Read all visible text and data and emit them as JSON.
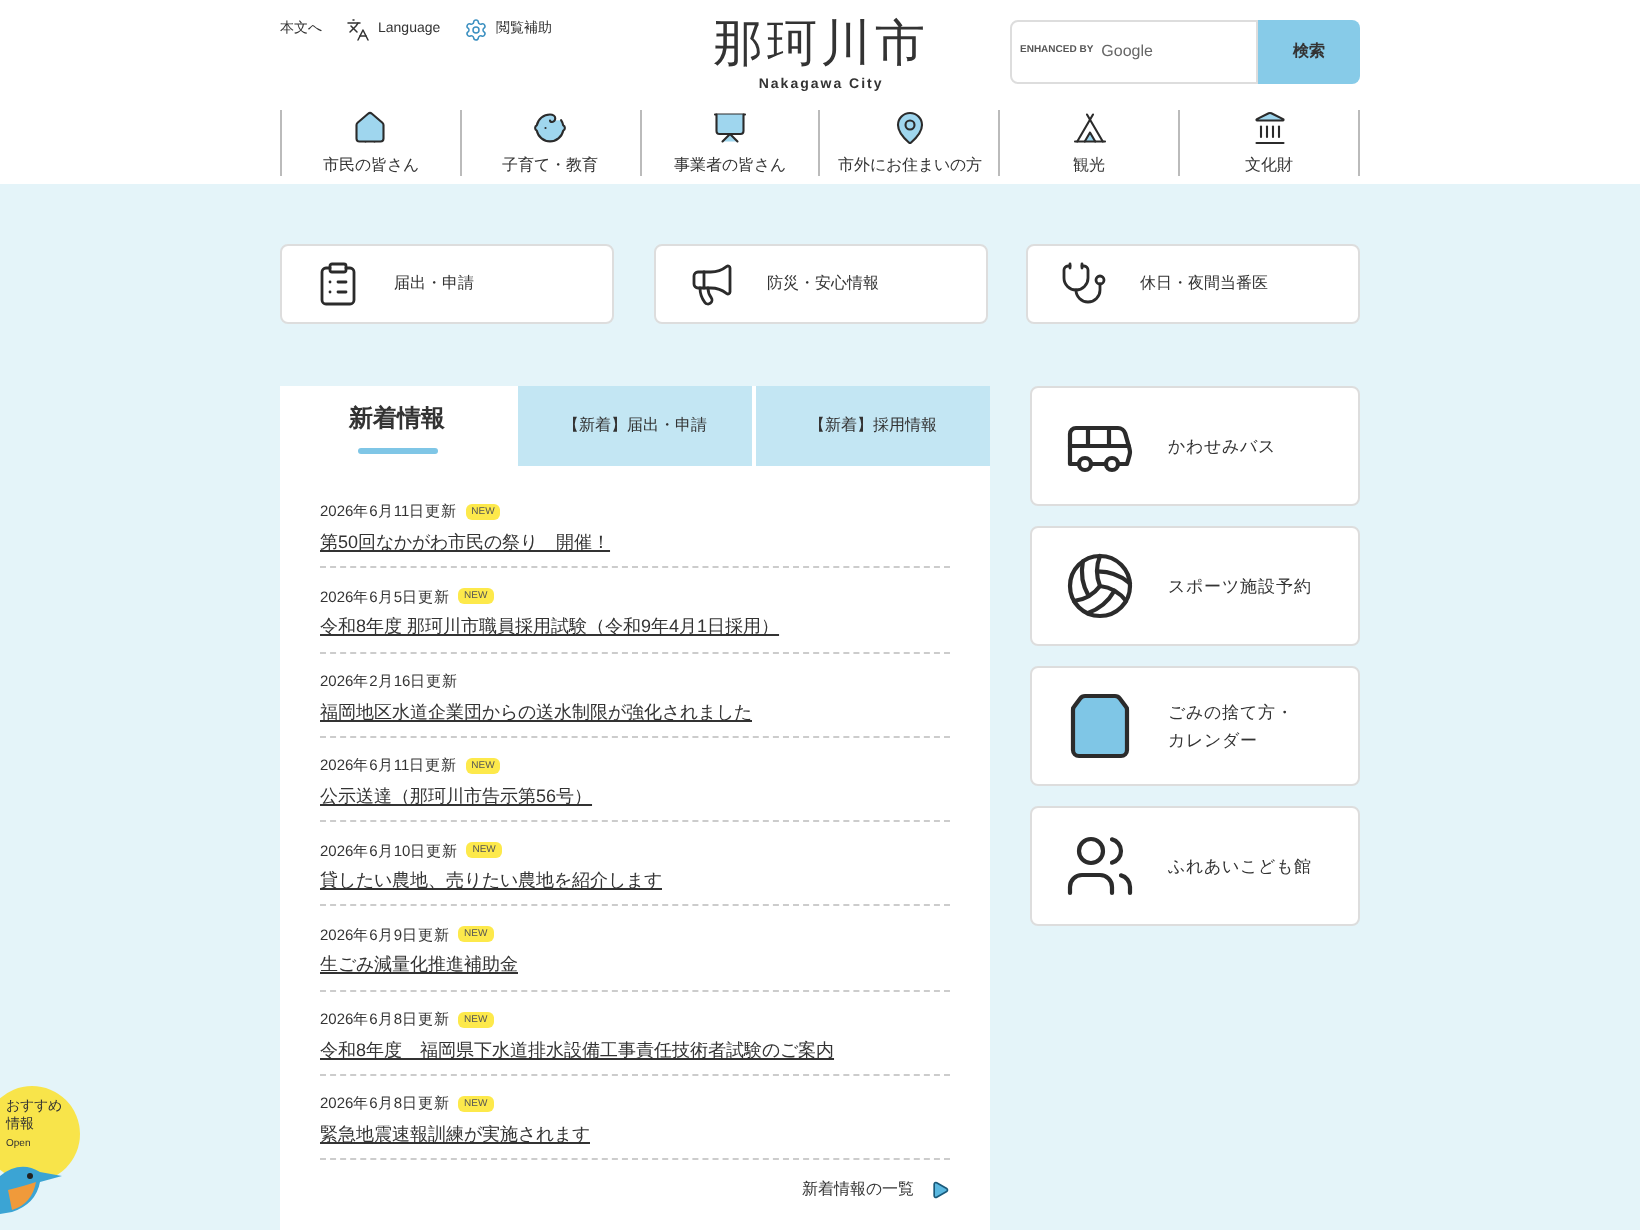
{
  "header": {
    "top_links": [
      {
        "label": "本文へ",
        "kind": "text"
      },
      {
        "label": "Language",
        "kind": "language"
      },
      {
        "label": "閲覧補助",
        "kind": "accessibility"
      }
    ],
    "logo": {
      "title": "那珂川市",
      "subtitle": "Nakagawa City"
    },
    "search": {
      "brand_prefix": "ENHANCED BY",
      "brand": "Google",
      "button": "検索"
    }
  },
  "nav": [
    {
      "label": "市民の皆さん",
      "kind": "home"
    },
    {
      "label": "子育て・教育",
      "kind": "family"
    },
    {
      "label": "事業者の皆さん",
      "kind": "business"
    },
    {
      "label": "市外にお住まいの方",
      "kind": "map"
    },
    {
      "label": "観光",
      "kind": "tent"
    },
    {
      "label": "文化財",
      "kind": "culture"
    }
  ],
  "quick_links": [
    {
      "label": "届出・申請",
      "kind": "form"
    },
    {
      "label": "防災・安心情報",
      "kind": "disaster"
    },
    {
      "label": "休日・夜間当番医",
      "kind": "doctor"
    }
  ],
  "news": {
    "tabs": [
      {
        "label": "新着情報",
        "selected": true
      },
      {
        "label": "【新着】届出・申請",
        "selected": false
      },
      {
        "label": "【新着】採用情報",
        "selected": false
      }
    ],
    "items": [
      {
        "date": "2026年6月11日更新",
        "new": true,
        "new_label": "NEW",
        "title": "第50回なかがわ市民の祭り　開催！"
      },
      {
        "date": "2026年6月5日更新",
        "new": true,
        "new_label": "NEW",
        "title": "令和8年度 那珂川市職員採用試験（令和9年4月1日採用）"
      },
      {
        "date": "2026年2月16日更新",
        "new": false,
        "title": "福岡地区水道企業団からの送水制限が強化されました"
      },
      {
        "date": "2026年6月11日更新",
        "new": true,
        "new_label": "NEW",
        "title": "公示送達（那珂川市告示第56号）"
      },
      {
        "date": "2026年6月10日更新",
        "new": true,
        "new_label": "NEW",
        "title": "貸したい農地、売りたい農地を紹介します"
      },
      {
        "date": "2026年6月9日更新",
        "new": true,
        "new_label": "NEW",
        "title": "生ごみ減量化推進補助金"
      },
      {
        "date": "2026年6月8日更新",
        "new": true,
        "new_label": "NEW",
        "title": "令和8年度　福岡県下水道排水設備工事責任技術者試験のご案内"
      },
      {
        "date": "2026年6月8日更新",
        "new": true,
        "new_label": "NEW",
        "title": "緊急地震速報訓練が実施されます"
      }
    ],
    "more_link": "新着情報の一覧"
  },
  "side_links": [
    {
      "label": "かわせみバス",
      "kind": "bus"
    },
    {
      "label": "スポーツ施設予約",
      "kind": "sports"
    },
    {
      "label": "ごみの捨て方・カレンダー",
      "kind": "garbage"
    },
    {
      "label": "ふれあいこども館",
      "kind": "kids"
    }
  ],
  "recommend": {
    "title": "おすすめ情報",
    "open": "Open"
  }
}
